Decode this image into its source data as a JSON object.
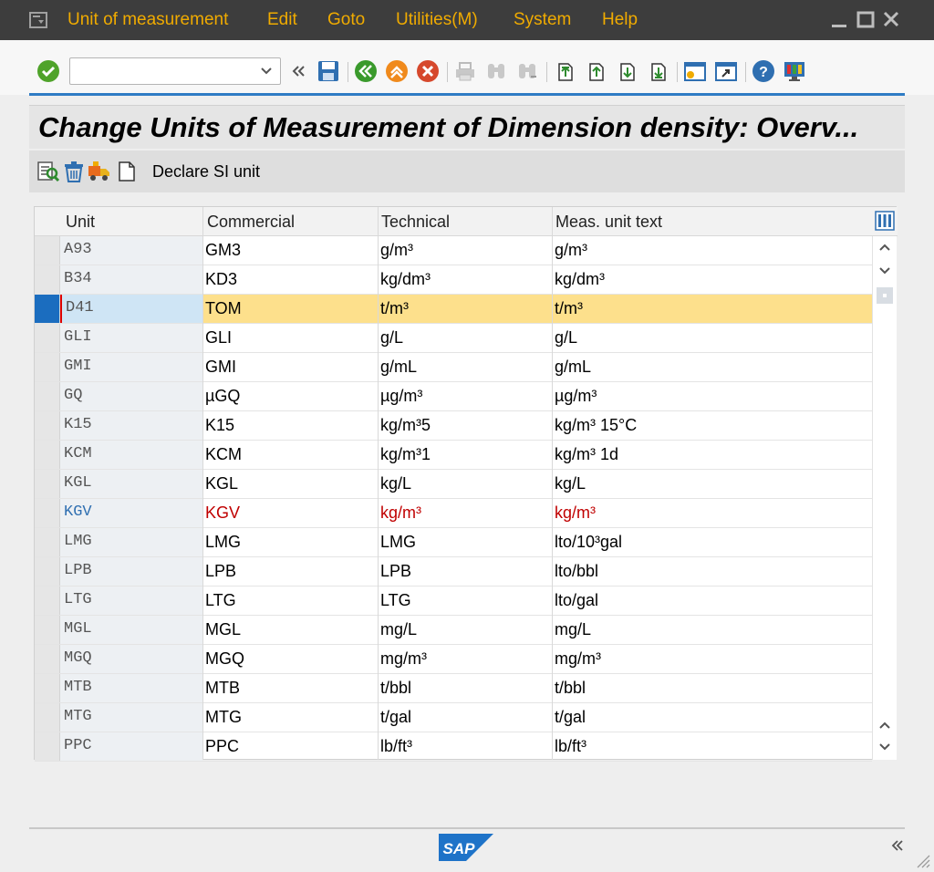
{
  "menu": {
    "items": [
      "Unit of measurement",
      "Edit",
      "Goto",
      "Utilities(M)",
      "System",
      "Help"
    ]
  },
  "toolbar": {
    "command_value": "",
    "icons": [
      "enter-icon",
      "command-dropdown-icon",
      "collapse-icon",
      "save-icon",
      "back-icon",
      "exit-icon",
      "cancel-icon",
      "print-icon",
      "find-icon",
      "find-next-icon",
      "first-page-icon",
      "previous-page-icon",
      "next-page-icon",
      "last-page-icon",
      "new-session-icon",
      "shortcut-icon",
      "help-icon",
      "customize-layout-icon"
    ]
  },
  "title": "Change Units of Measurement of Dimension density: Overv...",
  "app_toolbar": {
    "declare_si_label": "Declare SI unit",
    "icons": [
      "display-change-icon",
      "delete-icon",
      "transport-icon",
      "new-entries-icon"
    ]
  },
  "table": {
    "headers": [
      "Unit",
      "Commercial",
      "Technical",
      "Meas. unit text"
    ],
    "rows": [
      [
        "A93",
        "GM3",
        "g/m³",
        "g/m³"
      ],
      [
        "B34",
        "KD3",
        "kg/dm³",
        "kg/dm³"
      ],
      [
        "D41",
        "TOM",
        "t/m³",
        "t/m³"
      ],
      [
        "GLI",
        "GLI",
        "g/L",
        "g/L"
      ],
      [
        "GMI",
        "GMI",
        "g/mL",
        "g/mL"
      ],
      [
        "GQ",
        "µGQ",
        "µg/m³",
        "µg/m³"
      ],
      [
        "K15",
        "K15",
        "kg/m³5",
        "kg/m³ 15°C"
      ],
      [
        "KCM",
        "KCM",
        "kg/m³1",
        "kg/m³ 1d"
      ],
      [
        "KGL",
        "KGL",
        "kg/L",
        "kg/L"
      ],
      [
        "KGV",
        "KGV",
        "kg/m³",
        "kg/m³"
      ],
      [
        "LMG",
        "LMG",
        "LMG",
        "lto/10³gal"
      ],
      [
        "LPB",
        "LPB",
        "LPB",
        "lto/bbl"
      ],
      [
        "LTG",
        "LTG",
        "LTG",
        "lto/gal"
      ],
      [
        "MGL",
        "MGL",
        "mg/L",
        "mg/L"
      ],
      [
        "MGQ",
        "MGQ",
        "mg/m³",
        "mg/m³"
      ],
      [
        "MTB",
        "MTB",
        "t/bbl",
        "t/bbl"
      ],
      [
        "MTG",
        "MTG",
        "t/gal",
        "t/gal"
      ],
      [
        "PPC",
        "PPC",
        "lb/ft³",
        "lb/ft³"
      ]
    ],
    "selected_row": 2,
    "red_row": 9
  },
  "footer": {
    "logo_text": "SAP"
  },
  "colors": {
    "menubar": "#3d3d3d",
    "menu_text": "#f0ab00",
    "accent": "#2e7bc4",
    "selection": "#fde08c",
    "error_text": "#c00000"
  }
}
